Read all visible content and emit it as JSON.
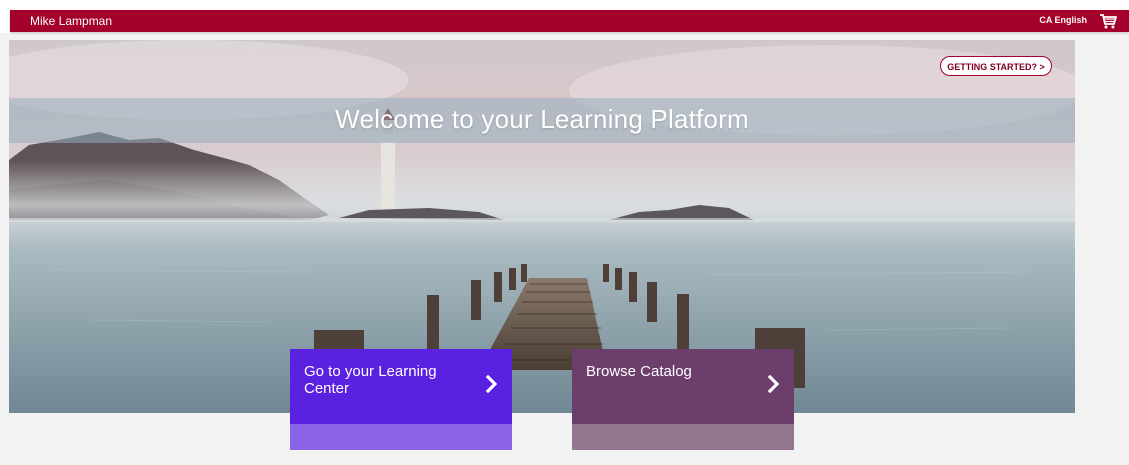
{
  "header": {
    "user_name": "Mike Lampman",
    "language": "CA English",
    "cart_icon": "shopping-cart-icon",
    "brand_color": "#a3002c"
  },
  "hero": {
    "title": "Welcome to your Learning Platform",
    "getting_started_label": "GETTING STARTED? >"
  },
  "tiles": [
    {
      "label": "Go to your Learning Center",
      "icon": "chevron-right-icon",
      "color": "#5b21e0"
    },
    {
      "label": "Browse Catalog",
      "icon": "chevron-right-icon",
      "color": "#6b3e6b"
    }
  ]
}
